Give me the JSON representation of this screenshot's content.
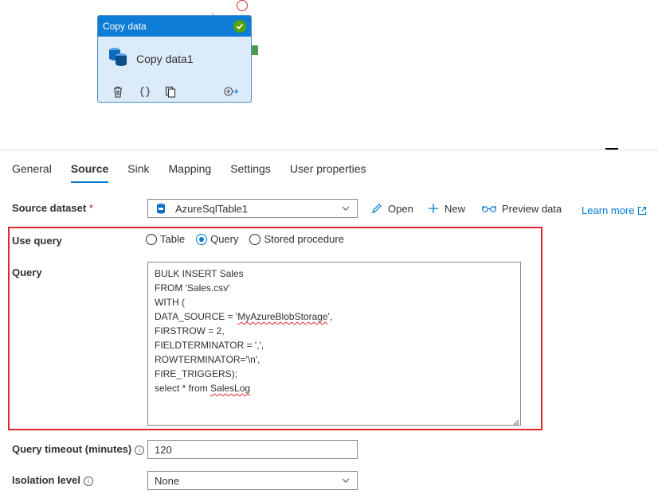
{
  "activity": {
    "type_label": "Copy data",
    "name": "Copy data1",
    "actions": [
      "delete-icon",
      "code-icon",
      "clone-icon",
      "add-output-icon"
    ],
    "status": "success"
  },
  "tabs": [
    {
      "label": "General"
    },
    {
      "label": "Source",
      "active": true
    },
    {
      "label": "Sink"
    },
    {
      "label": "Mapping"
    },
    {
      "label": "Settings"
    },
    {
      "label": "User properties"
    }
  ],
  "source": {
    "dataset_label": "Source dataset",
    "required_mark": "*",
    "dataset_value": "AzureSqlTable1",
    "open_label": "Open",
    "new_label": "New",
    "preview_label": "Preview data",
    "learn_more_label": "Learn more",
    "use_query_label": "Use query",
    "use_query_options": [
      "Table",
      "Query",
      "Stored procedure"
    ],
    "use_query_selected": "Query",
    "query_label": "Query",
    "query_lines": [
      "BULK INSERT Sales",
      "FROM 'Sales.csv'",
      "WITH (",
      "DATA_SOURCE = 'MyAzureBlobStorage',",
      "FIRSTROW = 2,",
      "FIELDTERMINATOR = ',',",
      "ROWTERMINATOR='\\n',",
      "FIRE_TRIGGERS);",
      "",
      "select * from SalesLog"
    ],
    "query_timeout_label": "Query timeout (minutes)",
    "query_timeout_value": "120",
    "isolation_label": "Isolation level",
    "isolation_value": "None"
  },
  "colors": {
    "accent": "#0078d4",
    "header_blue": "#0f7cd6",
    "highlight_red": "#e0262b",
    "success_green": "#57a300"
  }
}
